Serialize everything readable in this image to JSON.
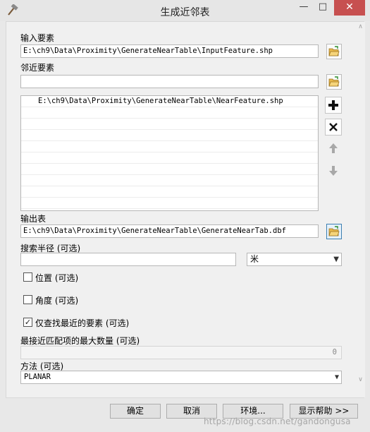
{
  "window": {
    "title": "生成近邻表",
    "controls": {
      "minimize": "—",
      "maximize": "□",
      "close": "✕"
    }
  },
  "form": {
    "input_features": {
      "label": "输入要素",
      "value": "E:\\ch9\\Data\\Proximity\\GenerateNearTable\\InputFeature.shp"
    },
    "near_features": {
      "label": "邻近要素",
      "value": "",
      "items": [
        "E:\\ch9\\Data\\Proximity\\GenerateNearTable\\NearFeature.shp"
      ]
    },
    "output_table": {
      "label": "输出表",
      "value": "E:\\ch9\\Data\\Proximity\\GenerateNearTable\\GenerateNearTab.dbf"
    },
    "search_radius": {
      "label": "搜索半径 (可选)",
      "value": "",
      "unit": "米"
    },
    "location": {
      "label": "位置 (可选)",
      "checked": false
    },
    "angle": {
      "label": "角度 (可选)",
      "checked": false
    },
    "closest": {
      "label": "仅查找最近的要素 (可选)",
      "checked": true
    },
    "max_matches": {
      "label": "最接近匹配项的最大数量 (可选)",
      "value": "0"
    },
    "method": {
      "label": "方法 (可选)",
      "value": "PLANAR"
    }
  },
  "buttons": {
    "ok": "确定",
    "cancel": "取消",
    "environments": "环境...",
    "show_help": "显示帮助 >>"
  },
  "watermark": "https://blog.csdn.net/gandongusa",
  "colors": {
    "close_button": "#c75050",
    "folder_icon": "#e8b84a",
    "active_border": "#3c7fb1"
  }
}
